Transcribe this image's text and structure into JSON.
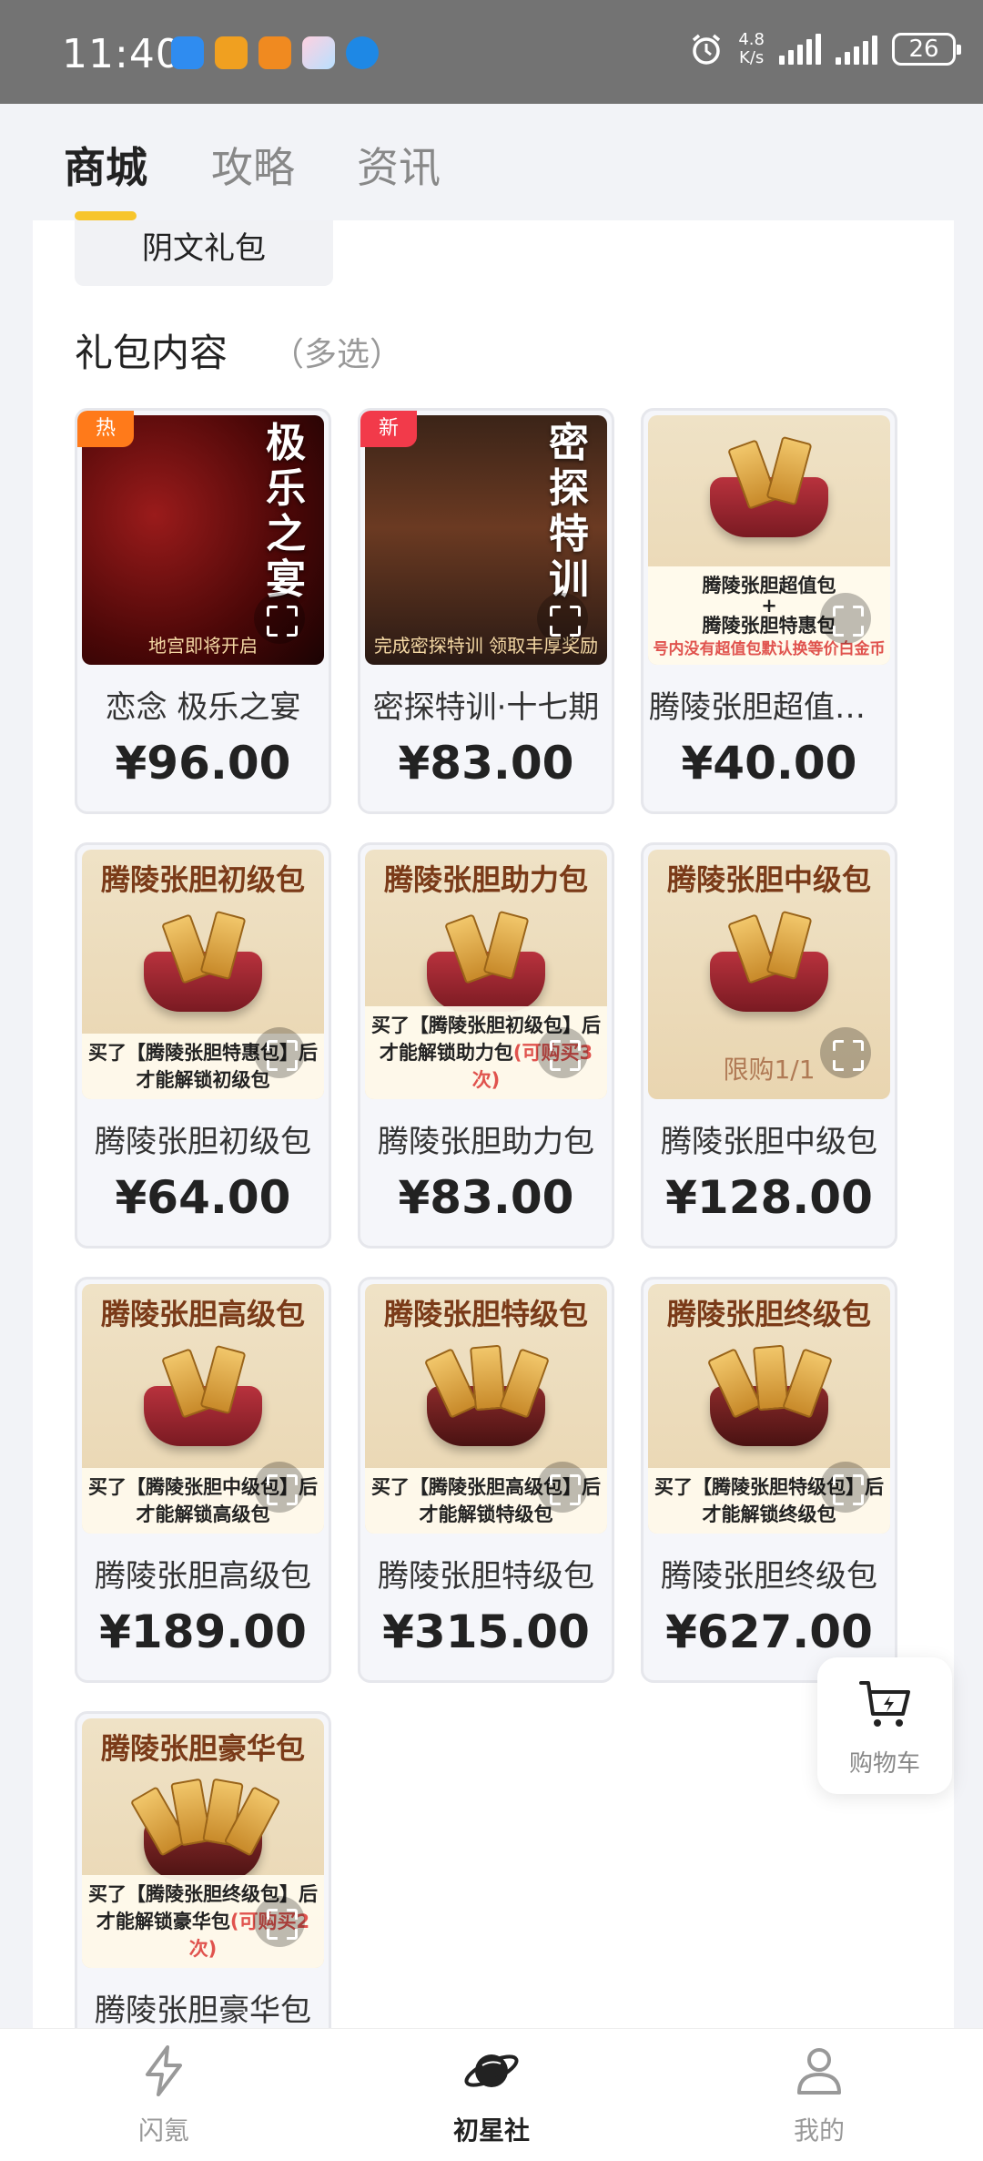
{
  "status_bar": {
    "time": "11:40",
    "net_speed_value": "4.8",
    "net_speed_unit": "K/s",
    "battery": "26"
  },
  "header": {
    "tabs": [
      {
        "label": "商城",
        "active": true
      },
      {
        "label": "攻略",
        "active": false
      },
      {
        "label": "资讯",
        "active": false
      }
    ]
  },
  "variant": {
    "label": "阴文礼包"
  },
  "section": {
    "title": "礼包内容",
    "subtitle": "（多选）"
  },
  "products": [
    {
      "name": "恋念 极乐之宴",
      "price": "¥96.00",
      "badge": "热",
      "art_title": "极乐之宴",
      "art_sub": "地宫即将开启"
    },
    {
      "name": "密探特训·十七期",
      "price": "¥83.00",
      "badge": "新",
      "art_title": "密探特训",
      "art_sub": "完成密探特训 领取丰厚奖励"
    },
    {
      "name": "腾陵张胆超值包…",
      "price": "¥40.00",
      "art_title_1": "腾陵张胆超值包",
      "art_title_plus": "+",
      "art_title_2": "腾陵张胆特惠包",
      "art_note": "号内没有超值包默认换等价白金币"
    },
    {
      "name": "腾陵张胆初级包",
      "price": "¥64.00",
      "art_title": "腾陵张胆初级包",
      "art_note_1": "买了【腾陵张胆特惠包】后",
      "art_note_2": "才能解锁初级包"
    },
    {
      "name": "腾陵张胆助力包",
      "price": "¥83.00",
      "art_title": "腾陵张胆助力包",
      "art_note_1": "买了【腾陵张胆初级包】后",
      "art_note_2": "才能解锁助力包",
      "art_note_red": "(可购买3次)"
    },
    {
      "name": "腾陵张胆中级包",
      "price": "¥128.00",
      "art_title": "腾陵张胆中级包",
      "art_limit": "限购1/1"
    },
    {
      "name": "腾陵张胆高级包",
      "price": "¥189.00",
      "art_title": "腾陵张胆高级包",
      "art_note_1": "买了【腾陵张胆中级包】后",
      "art_note_2": "才能解锁高级包"
    },
    {
      "name": "腾陵张胆特级包",
      "price": "¥315.00",
      "art_title": "腾陵张胆特级包",
      "art_note_1": "买了【腾陵张胆高级包】后",
      "art_note_2": "才能解锁特级包"
    },
    {
      "name": "腾陵张胆终级包",
      "price": "¥627.00",
      "art_title": "腾陵张胆终级包",
      "art_note_1": "买了【腾陵张胆特级包】后",
      "art_note_2": "才能解锁终级包"
    },
    {
      "name": "腾陵张胆豪华包",
      "price": "",
      "art_title": "腾陵张胆豪华包",
      "art_note_1": "买了【腾陵张胆终级包】后",
      "art_note_2": "才能解锁豪华包",
      "art_note_red": "(可购买2次)"
    }
  ],
  "cart": {
    "label": "购物车"
  },
  "bottom_nav": [
    {
      "label": "闪氪",
      "icon": "lightning-icon",
      "active": false
    },
    {
      "label": "初星社",
      "icon": "planet-icon",
      "active": true
    },
    {
      "label": "我的",
      "icon": "person-icon",
      "active": false
    }
  ],
  "colors": {
    "accent": "#f7c52c",
    "hot_badge": "#ff7a1a",
    "new_badge": "#f23a4a",
    "note_red": "#e0534e"
  }
}
